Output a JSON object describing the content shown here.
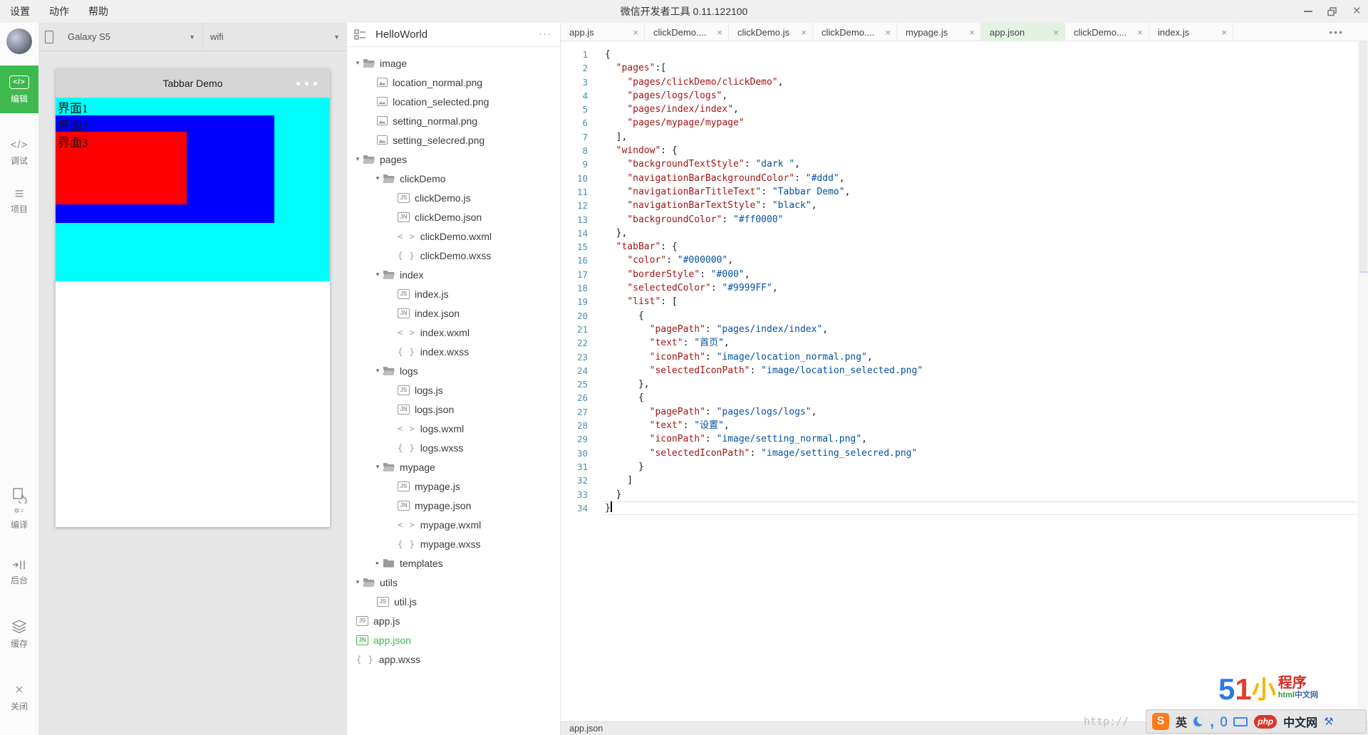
{
  "titlebar": {
    "menus": [
      "设置",
      "动作",
      "帮助"
    ],
    "title": "微信开发者工具 0.11.122100"
  },
  "sidebar": {
    "edit": "编辑",
    "debug": "调试",
    "project": "项目",
    "compile": "编译",
    "compile_sub": "⚙=",
    "background": "后台",
    "cache": "缓存",
    "close": "关闭",
    "accent_color": "#3eb94e"
  },
  "simulator": {
    "device": "Galaxy S5",
    "network": "wifi",
    "nav_title": "Tabbar Demo",
    "layers": [
      {
        "label": "界面1",
        "color": "#00ffff"
      },
      {
        "label": "界面2",
        "color": "#0000ff"
      },
      {
        "label": "界面3",
        "color": "#ff0000"
      }
    ]
  },
  "explorer": {
    "project": "HelloWorld",
    "more": "···",
    "items": [
      {
        "label": "image",
        "type": "folder",
        "level": 0,
        "arrow": "open"
      },
      {
        "label": "location_normal.png",
        "type": "img",
        "level": 1
      },
      {
        "label": "location_selected.png",
        "type": "img",
        "level": 1
      },
      {
        "label": "setting_normal.png",
        "type": "img",
        "level": 1
      },
      {
        "label": "setting_selecred.png",
        "type": "img",
        "level": 1
      },
      {
        "label": "pages",
        "type": "folder",
        "level": 0,
        "arrow": "open"
      },
      {
        "label": "clickDemo",
        "type": "folder",
        "level": 1,
        "arrow": "open"
      },
      {
        "label": "clickDemo.js",
        "type": "js",
        "level": 2
      },
      {
        "label": "clickDemo.json",
        "type": "jn",
        "level": 2
      },
      {
        "label": "clickDemo.wxml",
        "type": "wxml",
        "level": 2
      },
      {
        "label": "clickDemo.wxss",
        "type": "wxss",
        "level": 2
      },
      {
        "label": "index",
        "type": "folder",
        "level": 1,
        "arrow": "open"
      },
      {
        "label": "index.js",
        "type": "js",
        "level": 2
      },
      {
        "label": "index.json",
        "type": "jn",
        "level": 2
      },
      {
        "label": "index.wxml",
        "type": "wxml",
        "level": 2
      },
      {
        "label": "index.wxss",
        "type": "wxss",
        "level": 2
      },
      {
        "label": "logs",
        "type": "folder",
        "level": 1,
        "arrow": "open"
      },
      {
        "label": "logs.js",
        "type": "js",
        "level": 2
      },
      {
        "label": "logs.json",
        "type": "jn",
        "level": 2
      },
      {
        "label": "logs.wxml",
        "type": "wxml",
        "level": 2
      },
      {
        "label": "logs.wxss",
        "type": "wxss",
        "level": 2
      },
      {
        "label": "mypage",
        "type": "folder",
        "level": 1,
        "arrow": "open"
      },
      {
        "label": "mypage.js",
        "type": "js",
        "level": 2
      },
      {
        "label": "mypage.json",
        "type": "jn",
        "level": 2
      },
      {
        "label": "mypage.wxml",
        "type": "wxml",
        "level": 2
      },
      {
        "label": "mypage.wxss",
        "type": "wxss",
        "level": 2
      },
      {
        "label": "templates",
        "type": "folder",
        "level": 1,
        "arrow": "closed"
      },
      {
        "label": "utils",
        "type": "folder",
        "level": 0,
        "arrow": "open"
      },
      {
        "label": "util.js",
        "type": "js",
        "level": 1
      },
      {
        "label": "app.js",
        "type": "js",
        "level": 0
      },
      {
        "label": "app.json",
        "type": "jn",
        "level": 0,
        "selected": true
      },
      {
        "label": "app.wxss",
        "type": "wxss",
        "level": 0
      }
    ]
  },
  "editor": {
    "tabs": [
      {
        "label": "app.js"
      },
      {
        "label": "clickDemo...."
      },
      {
        "label": "clickDemo.js"
      },
      {
        "label": "clickDemo...."
      },
      {
        "label": "mypage.js"
      },
      {
        "label": "app.json",
        "active": true
      },
      {
        "label": "clickDemo...."
      },
      {
        "label": "index.js"
      }
    ],
    "overflow": "•••",
    "key_color": "#A31515",
    "value_color": "#0451A5",
    "cursor_line": 34,
    "lines": [
      [
        [
          "p",
          "{"
        ]
      ],
      [
        [
          "p",
          "  "
        ],
        [
          "k",
          "\"pages\""
        ],
        [
          "p",
          ":["
        ]
      ],
      [
        [
          "p",
          "    "
        ],
        [
          "k",
          "\"pages/clickDemo/clickDemo\""
        ],
        [
          "p",
          ","
        ]
      ],
      [
        [
          "p",
          "    "
        ],
        [
          "k",
          "\"pages/logs/logs\""
        ],
        [
          "p",
          ","
        ]
      ],
      [
        [
          "p",
          "    "
        ],
        [
          "k",
          "\"pages/index/index\""
        ],
        [
          "p",
          ","
        ]
      ],
      [
        [
          "p",
          "    "
        ],
        [
          "k",
          "\"pages/mypage/mypage\""
        ]
      ],
      [
        [
          "p",
          "  ],"
        ]
      ],
      [
        [
          "p",
          "  "
        ],
        [
          "k",
          "\"window\""
        ],
        [
          "p",
          ": {"
        ]
      ],
      [
        [
          "p",
          "    "
        ],
        [
          "k",
          "\"backgroundTextStyle\""
        ],
        [
          "p",
          ": "
        ],
        [
          "v",
          "\"dark \""
        ],
        [
          "p",
          ","
        ]
      ],
      [
        [
          "p",
          "    "
        ],
        [
          "k",
          "\"navigationBarBackgroundColor\""
        ],
        [
          "p",
          ": "
        ],
        [
          "v",
          "\"#ddd\""
        ],
        [
          "p",
          ","
        ]
      ],
      [
        [
          "p",
          "    "
        ],
        [
          "k",
          "\"navigationBarTitleText\""
        ],
        [
          "p",
          ": "
        ],
        [
          "v",
          "\"Tabbar Demo\""
        ],
        [
          "p",
          ","
        ]
      ],
      [
        [
          "p",
          "    "
        ],
        [
          "k",
          "\"navigationBarTextStyle\""
        ],
        [
          "p",
          ": "
        ],
        [
          "v",
          "\"black\""
        ],
        [
          "p",
          ","
        ]
      ],
      [
        [
          "p",
          "    "
        ],
        [
          "k",
          "\"backgroundColor\""
        ],
        [
          "p",
          ": "
        ],
        [
          "v",
          "\"#ff0000\""
        ]
      ],
      [
        [
          "p",
          "  },"
        ]
      ],
      [
        [
          "p",
          "  "
        ],
        [
          "k",
          "\"tabBar\""
        ],
        [
          "p",
          ": {"
        ]
      ],
      [
        [
          "p",
          "    "
        ],
        [
          "k",
          "\"color\""
        ],
        [
          "p",
          ": "
        ],
        [
          "v",
          "\"#000000\""
        ],
        [
          "p",
          ","
        ]
      ],
      [
        [
          "p",
          "    "
        ],
        [
          "k",
          "\"borderStyle\""
        ],
        [
          "p",
          ": "
        ],
        [
          "v",
          "\"#000\""
        ],
        [
          "p",
          ","
        ]
      ],
      [
        [
          "p",
          "    "
        ],
        [
          "k",
          "\"selectedColor\""
        ],
        [
          "p",
          ": "
        ],
        [
          "v",
          "\"#9999FF\""
        ],
        [
          "p",
          ","
        ]
      ],
      [
        [
          "p",
          "    "
        ],
        [
          "k",
          "\"list\""
        ],
        [
          "p",
          ": ["
        ]
      ],
      [
        [
          "p",
          "      {"
        ]
      ],
      [
        [
          "p",
          "        "
        ],
        [
          "k",
          "\"pagePath\""
        ],
        [
          "p",
          ": "
        ],
        [
          "v",
          "\"pages/index/index\""
        ],
        [
          "p",
          ","
        ]
      ],
      [
        [
          "p",
          "        "
        ],
        [
          "k",
          "\"text\""
        ],
        [
          "p",
          ": "
        ],
        [
          "v",
          "\"首页\""
        ],
        [
          "p",
          ","
        ]
      ],
      [
        [
          "p",
          "        "
        ],
        [
          "k",
          "\"iconPath\""
        ],
        [
          "p",
          ": "
        ],
        [
          "v",
          "\"image/location_normal.png\""
        ],
        [
          "p",
          ","
        ]
      ],
      [
        [
          "p",
          "        "
        ],
        [
          "k",
          "\"selectedIconPath\""
        ],
        [
          "p",
          ": "
        ],
        [
          "v",
          "\"image/location_selected.png\""
        ]
      ],
      [
        [
          "p",
          "      },"
        ]
      ],
      [
        [
          "p",
          "      {"
        ]
      ],
      [
        [
          "p",
          "        "
        ],
        [
          "k",
          "\"pagePath\""
        ],
        [
          "p",
          ": "
        ],
        [
          "v",
          "\"pages/logs/logs\""
        ],
        [
          "p",
          ","
        ]
      ],
      [
        [
          "p",
          "        "
        ],
        [
          "k",
          "\"text\""
        ],
        [
          "p",
          ": "
        ],
        [
          "v",
          "\"设置\""
        ],
        [
          "p",
          ","
        ]
      ],
      [
        [
          "p",
          "        "
        ],
        [
          "k",
          "\"iconPath\""
        ],
        [
          "p",
          ": "
        ],
        [
          "v",
          "\"image/setting_normal.png\""
        ],
        [
          "p",
          ","
        ]
      ],
      [
        [
          "p",
          "        "
        ],
        [
          "k",
          "\"selectedIconPath\""
        ],
        [
          "p",
          ": "
        ],
        [
          "v",
          "\"image/setting_selecred.png\""
        ]
      ],
      [
        [
          "p",
          "      }"
        ]
      ],
      [
        [
          "p",
          "    ]"
        ]
      ],
      [
        [
          "p",
          "  }"
        ]
      ],
      [
        [
          "p",
          "}"
        ]
      ]
    ]
  },
  "statusbar": {
    "file": "app.json"
  },
  "watermark": {
    "url": "http://",
    "logo_5": "5",
    "logo_1": "1",
    "logo_xiao": "小",
    "logo_chengxu": "程序",
    "sub_html": "html",
    "sub_site": "中文网",
    "ime_s": "S",
    "ime_lang": "英",
    "php": "php",
    "php_site": "中文网"
  }
}
